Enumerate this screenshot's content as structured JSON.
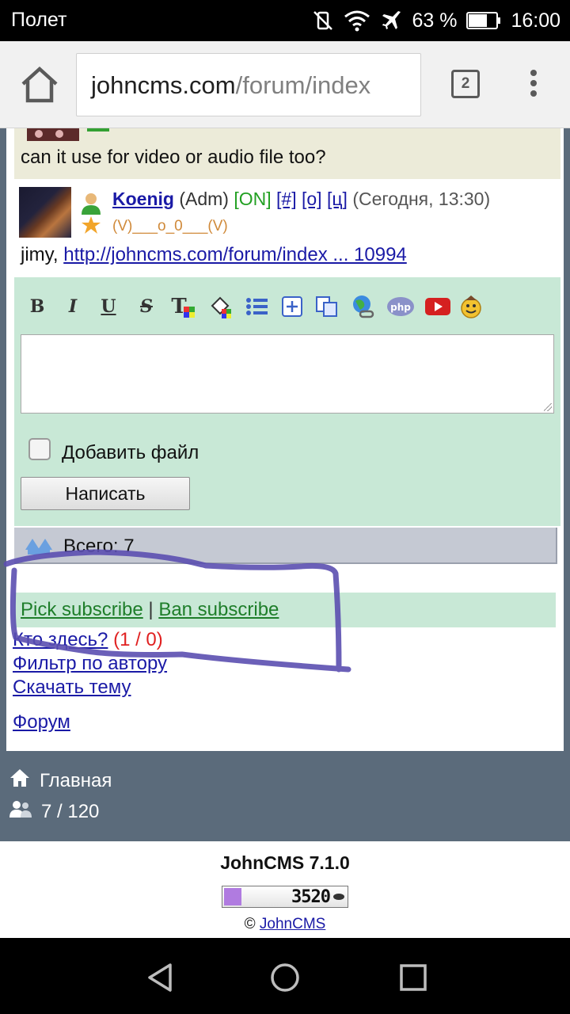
{
  "status_bar": {
    "carrier": "Полет",
    "battery_percent": "63 %",
    "time": "16:00"
  },
  "browser": {
    "url_host": "johncms.com",
    "url_path": "/forum/index",
    "tab_count": "2"
  },
  "post_prev": {
    "text": "can it use for video or audio file too?"
  },
  "post": {
    "author": "Koenig",
    "role": "(Adm)",
    "online": "[ON]",
    "link_hash": "[#]",
    "link_o": "[о]",
    "link_c": "[ц]",
    "time": "(Сегодня, 13:30)",
    "user_status": "(V)___o_0___(V)",
    "text_prefix": "jimy,",
    "text_link": "http://johncms.com/forum/index ... 10994"
  },
  "editor": {
    "toolbar": [
      {
        "icon": "bold-icon",
        "label": "B"
      },
      {
        "icon": "italic-icon",
        "label": "I"
      },
      {
        "icon": "underline-icon",
        "label": "U"
      },
      {
        "icon": "strikethrough-icon",
        "label": "S"
      },
      {
        "icon": "text-color-icon",
        "label": "T"
      },
      {
        "icon": "background-color-icon",
        "label": ""
      },
      {
        "icon": "list-icon",
        "label": ""
      },
      {
        "icon": "spoiler-icon",
        "label": ""
      },
      {
        "icon": "quote-icon",
        "label": ""
      },
      {
        "icon": "url-icon",
        "label": ""
      },
      {
        "icon": "php-code-icon",
        "label": "php"
      },
      {
        "icon": "youtube-icon",
        "label": ""
      },
      {
        "icon": "smiley-icon",
        "label": ""
      }
    ],
    "textarea_value": "",
    "attach_file_label": "Добавить файл",
    "attach_checked": false,
    "submit_label": "Написать"
  },
  "total": {
    "label": "Всего: 7"
  },
  "subscribe": {
    "pick": "Pick subscribe",
    "separator": "|",
    "ban": "Ban subscribe"
  },
  "links": {
    "who_here": "Кто здесь?",
    "who_count": "(1 / 0)",
    "filter_by_author": "Фильтр по автору",
    "download_topic": "Скачать тему",
    "forum": "Форум"
  },
  "footer_nav": {
    "home": "Главная",
    "online_count": "7 / 120"
  },
  "credits": {
    "version": "JohnCMS 7.1.0",
    "counter_value": "3520",
    "copyright_symbol": "©",
    "copyright_link": "JohnCMS"
  },
  "colors": {
    "editor_bg": "#c8e8d6",
    "footer_bg": "#5b6b7b",
    "link_blue": "#1a1aa6",
    "annotation_stroke": "#5b4fb0"
  }
}
